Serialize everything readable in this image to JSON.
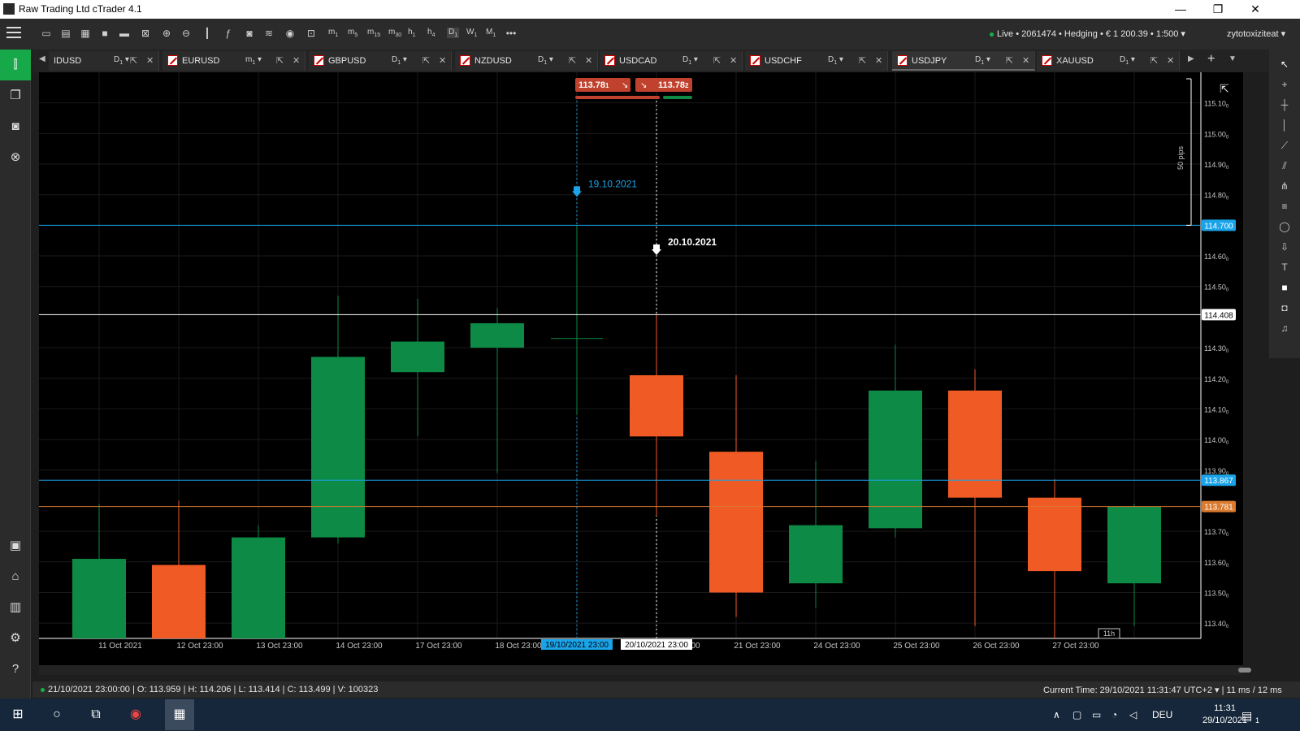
{
  "window": {
    "title": "Raw Trading Ltd cTrader 4.1",
    "min": "—",
    "restore": "❐",
    "close": "✕"
  },
  "toolbar": {
    "timeframes": [
      {
        "l": "m",
        "s": "1"
      },
      {
        "l": "m",
        "s": "5"
      },
      {
        "l": "m",
        "s": "15"
      },
      {
        "l": "m",
        "s": "30"
      },
      {
        "l": "h",
        "s": "1"
      },
      {
        "l": "h",
        "s": "4"
      },
      {
        "l": "D",
        "s": "1"
      },
      {
        "l": "W",
        "s": "1"
      },
      {
        "l": "M",
        "s": "1"
      }
    ],
    "more": "•••",
    "account": "Live • 2061474 • Hedging • € 1 200.39 • 1:500",
    "user": "zytotoxiziteat"
  },
  "tabs": [
    {
      "symbol": "IDUSD",
      "tf": "D",
      "sub": "1",
      "active": false
    },
    {
      "symbol": "EURUSD",
      "tf": "m",
      "sub": "1",
      "active": false
    },
    {
      "symbol": "GBPUSD",
      "tf": "D",
      "sub": "1",
      "active": false
    },
    {
      "symbol": "NZDUSD",
      "tf": "D",
      "sub": "1",
      "active": false
    },
    {
      "symbol": "USDCAD",
      "tf": "D",
      "sub": "1",
      "active": false
    },
    {
      "symbol": "USDCHF",
      "tf": "D",
      "sub": "1",
      "active": false
    },
    {
      "symbol": "USDJPY",
      "tf": "D",
      "sub": "1",
      "active": true
    },
    {
      "symbol": "XAUUSD",
      "tf": "D",
      "sub": "1",
      "active": false
    }
  ],
  "chart_data": {
    "type": "candlestick",
    "symbol": "USDJPY",
    "timeframe": "D1",
    "ylim": [
      113.35,
      115.2
    ],
    "y_ticks": [
      {
        "v": 115.1,
        "label": "115.10",
        "sup": "0"
      },
      {
        "v": 115.0,
        "label": "115.00",
        "sup": "0"
      },
      {
        "v": 114.9,
        "label": "114.90",
        "sup": "0"
      },
      {
        "v": 114.8,
        "label": "114.80",
        "sup": "0"
      },
      {
        "v": 114.6,
        "label": "114.60",
        "sup": "0"
      },
      {
        "v": 114.5,
        "label": "114.50",
        "sup": "0"
      },
      {
        "v": 114.3,
        "label": "114.30",
        "sup": "0"
      },
      {
        "v": 114.2,
        "label": "114.20",
        "sup": "0"
      },
      {
        "v": 114.1,
        "label": "114.10",
        "sup": "0"
      },
      {
        "v": 114.0,
        "label": "114.00",
        "sup": "0"
      },
      {
        "v": 113.9,
        "label": "113.90",
        "sup": "0"
      },
      {
        "v": 113.7,
        "label": "113.70",
        "sup": "0"
      },
      {
        "v": 113.6,
        "label": "113.60",
        "sup": "0"
      },
      {
        "v": 113.5,
        "label": "113.50",
        "sup": "0"
      },
      {
        "v": 113.4,
        "label": "113.40",
        "sup": "0"
      }
    ],
    "x_labels": [
      "11 Oct 2021",
      "12 Oct 23:00",
      "13 Oct 23:00",
      "14 Oct 23:00",
      "17 Oct 23:00",
      "18 Oct 23:00",
      "",
      "",
      "21 Oct 23:00",
      "24 Oct 23:00",
      "25 Oct 23:00",
      "26 Oct 23:00",
      "27 Oct 23:00",
      ""
    ],
    "candles": [
      {
        "o": 113.35,
        "h": 113.79,
        "l": 113.35,
        "c": 113.61
      },
      {
        "o": 113.59,
        "h": 113.8,
        "l": 113.35,
        "c": 113.35
      },
      {
        "o": 113.35,
        "h": 113.72,
        "l": 113.35,
        "c": 113.68
      },
      {
        "o": 113.68,
        "h": 114.47,
        "l": 113.66,
        "c": 114.27
      },
      {
        "o": 114.22,
        "h": 114.46,
        "l": 114.01,
        "c": 114.32
      },
      {
        "o": 114.3,
        "h": 114.43,
        "l": 113.89,
        "c": 114.38
      },
      {
        "o": 114.33,
        "h": 114.7,
        "l": 114.08,
        "c": 114.33
      },
      {
        "o": 114.21,
        "h": 114.41,
        "l": 113.75,
        "c": 114.01
      },
      {
        "o": 113.96,
        "h": 114.21,
        "l": 113.42,
        "c": 113.5
      },
      {
        "o": 113.53,
        "h": 113.93,
        "l": 113.45,
        "c": 113.72
      },
      {
        "o": 113.71,
        "h": 114.31,
        "l": 113.68,
        "c": 114.16
      },
      {
        "o": 114.16,
        "h": 114.23,
        "l": 113.39,
        "c": 113.81
      },
      {
        "o": 113.81,
        "h": 113.87,
        "l": 113.35,
        "c": 113.57
      },
      {
        "o": 113.53,
        "h": 113.79,
        "l": 113.39,
        "c": 113.78
      }
    ],
    "lines": [
      {
        "v": 114.7,
        "color": "#1aa3e8",
        "label": "114.700"
      },
      {
        "v": 114.408,
        "color": "#ffffff",
        "label": "114.408",
        "dark": true
      },
      {
        "v": 113.867,
        "color": "#1aa3e8",
        "label": "113.867"
      },
      {
        "v": 113.781,
        "color": "#d97a2e",
        "label": "113.781"
      }
    ],
    "markers": [
      {
        "idx": 6,
        "v": 114.7,
        "color": "#1aa3e8",
        "label": "19.10.2021"
      },
      {
        "idx": 7,
        "v": 114.51,
        "color": "#ffffff",
        "label": "20.10.2021"
      }
    ],
    "cursor_dates": [
      {
        "idx": 6,
        "label": "19/10/2021 23:00",
        "bg": "#1aa3e8",
        "fg": "#000000"
      },
      {
        "idx": 7,
        "label": "20/10/2021 23:00",
        "bg": "#ffffff",
        "fg": "#000000"
      }
    ],
    "partial_labels": [
      {
        "idx": 7,
        "text": "00"
      }
    ],
    "quote": {
      "sell": "113.78",
      "sell_sup": "1",
      "buy": "113.78",
      "buy_sup": "2",
      "color": "#c0412d"
    },
    "pips_label": "50 pips",
    "countdown": "11h",
    "colors": {
      "bull": "#0d8a45",
      "bear": "#f05a24",
      "grid": "#1a1a1a"
    }
  },
  "status": {
    "ohlc": "21/10/2021 23:00:00 | O: 113.959 | H: 114.206 | L: 113.414 | C: 113.499 | V: 100323",
    "current_time": "Current Time: 29/10/2021 11:31:47   UTC+2  ▾  |  11 ms / 12 ms"
  },
  "taskbar": {
    "lang": "DEU",
    "time": "11:31",
    "date": "29/10/2021",
    "notif": "1"
  }
}
